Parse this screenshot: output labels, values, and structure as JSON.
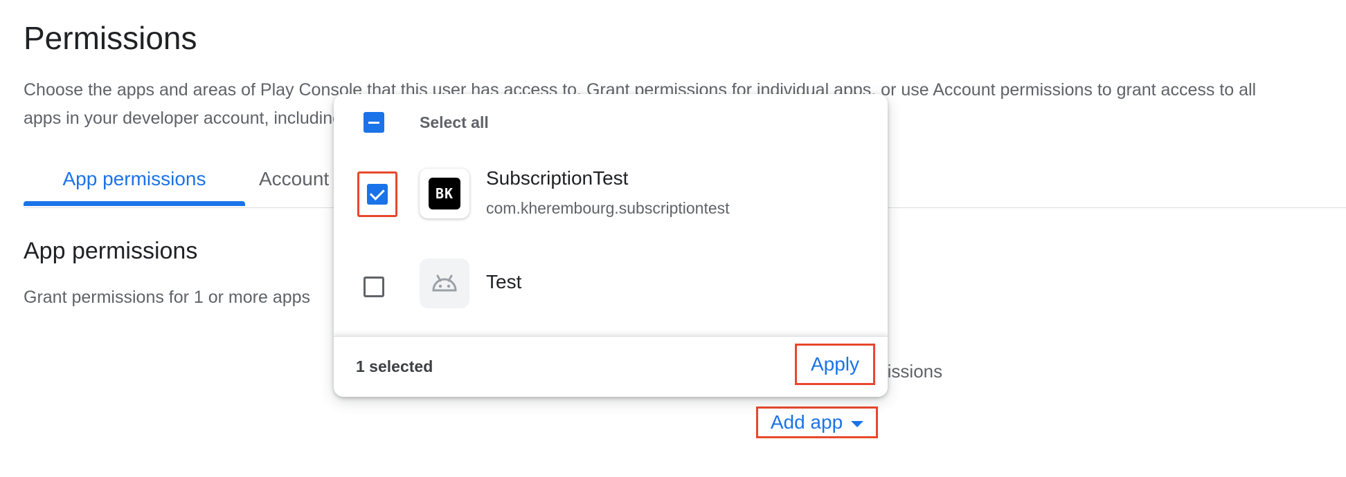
{
  "page": {
    "title": "Permissions",
    "description": "Choose the apps and areas of Play Console that this user has access to. Grant permissions for individual apps, or use Account permissions to grant access to all apps in your developer account, including new apps and future access."
  },
  "tabs": [
    {
      "label": "App permissions",
      "active": true
    },
    {
      "label": "Account permissions",
      "active": false
    }
  ],
  "section": {
    "title": "App permissions",
    "description": "Grant permissions for 1 or more apps"
  },
  "background_text": "missions",
  "add_app": {
    "label": "Add app",
    "icon": "arrow-drop-down-icon"
  },
  "popup": {
    "select_all": {
      "label": "Select all",
      "state": "indeterminate"
    },
    "apps": [
      {
        "name": "SubscriptionTest",
        "package": "com.kherembourg.subscriptiontest",
        "checked": true,
        "icon": "BK"
      },
      {
        "name": "Test",
        "package": "",
        "checked": false,
        "icon": "android-icon"
      }
    ],
    "selected_count": "1 selected",
    "apply_label": "Apply"
  },
  "colors": {
    "accent": "#1a73e8",
    "highlight": "#e8472c",
    "text_secondary": "#5f6368"
  }
}
